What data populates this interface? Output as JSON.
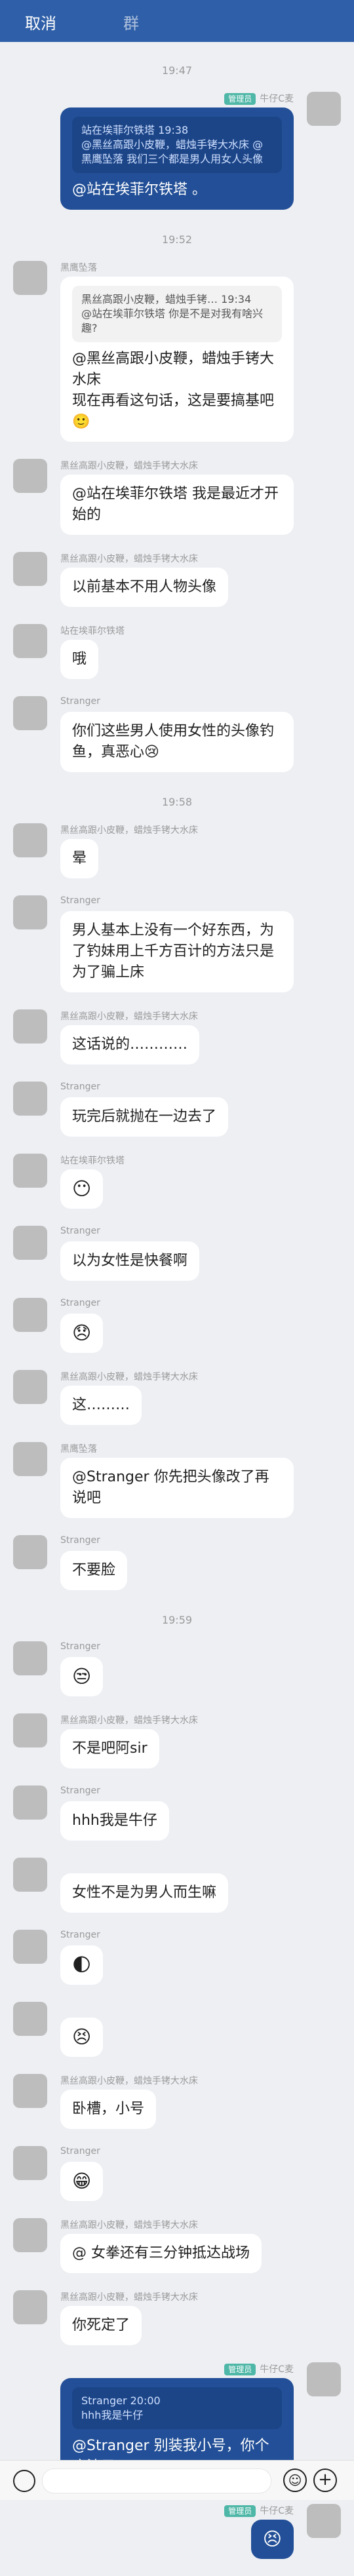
{
  "header": {
    "cancel": "取消",
    "title": "群"
  },
  "messages": [
    {
      "type": "time",
      "text": "19:47"
    },
    {
      "type": "msg",
      "side": "right",
      "role": "管理员",
      "name": "牛仔C麦",
      "quote": "站在埃菲尔铁塔 19:38\n@黑丝高跟小皮鞭，蜡烛手铐大水床 @黑鹰坠落 我们三个都是男人用女人头像",
      "text": "@站在埃菲尔铁塔 。"
    },
    {
      "type": "time",
      "text": "19:52"
    },
    {
      "type": "msg",
      "side": "left",
      "name": "黑鹰坠落",
      "quote": "黑丝高跟小皮鞭，蜡烛手铐…   19:34\n@站在埃菲尔铁塔 你是不是对我有啥兴趣?",
      "text": "@黑丝高跟小皮鞭，蜡烛手铐大水床\n现在再看这句话，这是要搞基吧🙂"
    },
    {
      "type": "msg",
      "side": "left",
      "name": "黑丝高跟小皮鞭，蜡烛手铐大水床",
      "text": "@站在埃菲尔铁塔 我是最近才开始的"
    },
    {
      "type": "msg",
      "side": "left",
      "name": "黑丝高跟小皮鞭，蜡烛手铐大水床",
      "text": "以前基本不用人物头像"
    },
    {
      "type": "msg",
      "side": "left",
      "name": "站在埃菲尔铁塔",
      "text": "哦"
    },
    {
      "type": "msg",
      "side": "left",
      "name": "Stranger",
      "text": "你们这些男人使用女性的头像钓鱼，真恶心😢"
    },
    {
      "type": "time",
      "text": "19:58"
    },
    {
      "type": "msg",
      "side": "left",
      "name": "黑丝高跟小皮鞭，蜡烛手铐大水床",
      "text": "晕"
    },
    {
      "type": "msg",
      "side": "left",
      "name": "Stranger",
      "text": "男人基本上没有一个好东西，为了钓妹用上千方百计的方法只是为了骗上床"
    },
    {
      "type": "msg",
      "side": "left",
      "name": "黑丝高跟小皮鞭，蜡烛手铐大水床",
      "text": "这话说的…………"
    },
    {
      "type": "msg",
      "side": "left",
      "name": "Stranger",
      "text": "玩完后就抛在一边去了"
    },
    {
      "type": "msg",
      "side": "left",
      "name": "站在埃菲尔铁塔",
      "text": "😶"
    },
    {
      "type": "msg",
      "side": "left",
      "name": "Stranger",
      "text": "以为女性是快餐啊"
    },
    {
      "type": "msg",
      "side": "left",
      "name": "Stranger",
      "text": "😞"
    },
    {
      "type": "msg",
      "side": "left",
      "name": "黑丝高跟小皮鞭，蜡烛手铐大水床",
      "text": "这………"
    },
    {
      "type": "msg",
      "side": "left",
      "name": "黑鹰坠落",
      "text": "@Stranger 你先把头像改了再说吧"
    },
    {
      "type": "msg",
      "side": "left",
      "name": "Stranger",
      "text": "不要脸"
    },
    {
      "type": "time",
      "text": "19:59"
    },
    {
      "type": "msg",
      "side": "left",
      "name": "Stranger",
      "text": "😒"
    },
    {
      "type": "msg",
      "side": "left",
      "name": "黑丝高跟小皮鞭，蜡烛手铐大水床",
      "text": "不是吧阿sir"
    },
    {
      "type": "msg",
      "side": "left",
      "name": "Stranger",
      "text": "hhh我是牛仔"
    },
    {
      "type": "msg",
      "side": "left",
      "name": "",
      "text": "女性不是为男人而生嘛"
    },
    {
      "type": "msg",
      "side": "left",
      "name": "Stranger",
      "text": "🌓"
    },
    {
      "type": "msg",
      "side": "left",
      "name": "",
      "text": "😣"
    },
    {
      "type": "msg",
      "side": "left",
      "name": "黑丝高跟小皮鞭，蜡烛手铐大水床",
      "text": "卧槽，小号"
    },
    {
      "type": "msg",
      "side": "left",
      "name": "Stranger",
      "text": "😁"
    },
    {
      "type": "msg",
      "side": "left",
      "name": "黑丝高跟小皮鞭，蜡烛手铐大水床",
      "text": "@ 女拳还有三分钟抵达战场"
    },
    {
      "type": "msg",
      "side": "left",
      "name": "黑丝高跟小皮鞭，蜡烛手铐大水床",
      "text": "你死定了"
    },
    {
      "type": "msg",
      "side": "right",
      "role": "管理员",
      "name": "牛仔C麦",
      "quote": "Stranger 20:00\nhhh我是牛仔",
      "text": "@Stranger 别装我小号，你个疯婆子"
    },
    {
      "type": "msg",
      "side": "right",
      "role": "管理员",
      "name": "牛仔C麦",
      "text": "😣"
    }
  ],
  "bottom": {
    "emoji_icon": "☺",
    "plus_icon": "+"
  }
}
